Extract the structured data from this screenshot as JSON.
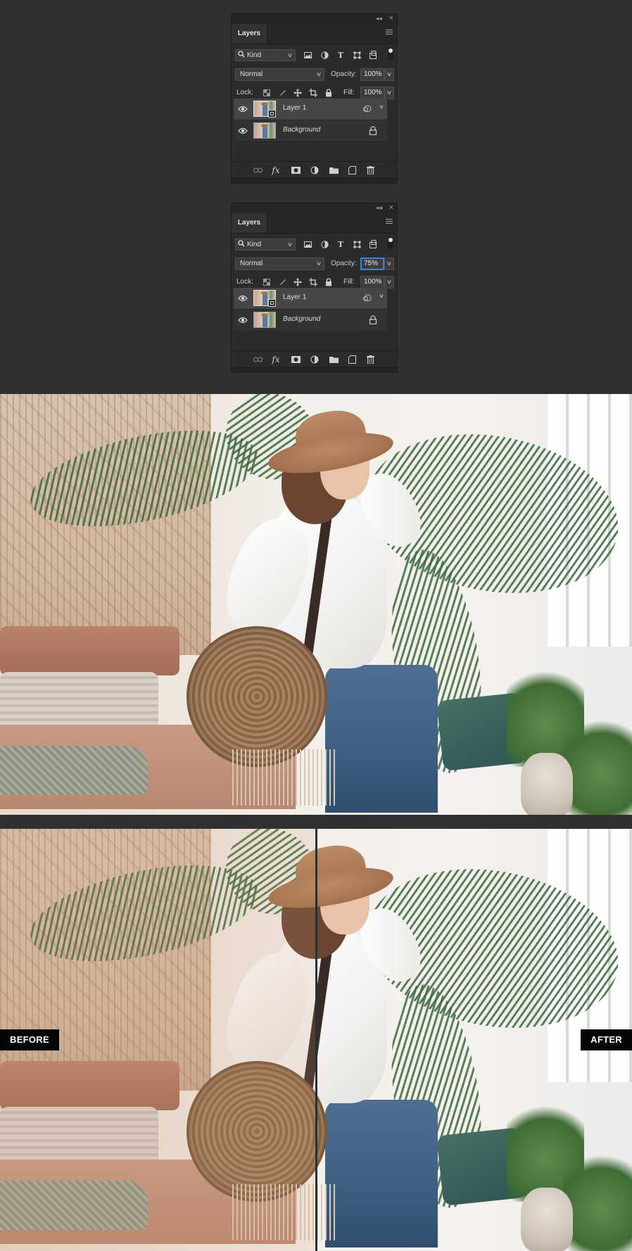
{
  "panel_top": {
    "tab_label": "Layers",
    "filter_kind": "Kind",
    "blend_mode": "Normal",
    "opacity_label": "Opacity:",
    "opacity_value": "100%",
    "lock_label": "Lock:",
    "fill_label": "Fill:",
    "fill_value": "100%",
    "layers": [
      {
        "name": "Layer 1"
      },
      {
        "name": "Background"
      }
    ]
  },
  "panel_bottom": {
    "tab_label": "Layers",
    "filter_kind": "Kind",
    "blend_mode": "Normal",
    "opacity_label": "Opacity:",
    "opacity_value": "75%",
    "lock_label": "Lock:",
    "fill_label": "Fill:",
    "fill_value": "100%",
    "layers": [
      {
        "name": "Layer 1"
      },
      {
        "name": "Background"
      }
    ]
  },
  "comparison": {
    "before_label": "BEFORE",
    "after_label": "AFTER"
  },
  "colors": {
    "app_background": "#313131",
    "panel_background": "#2b2b2b",
    "selected_layer": "#464646",
    "active_field_border": "#3b7fe0",
    "label_background": "#050505"
  },
  "icons": [
    "search-icon",
    "image-filter-icon",
    "adjustment-filter-icon",
    "type-filter-icon",
    "shape-filter-icon",
    "smart-object-filter-icon",
    "lock-transparent-icon",
    "lock-image-icon",
    "lock-position-icon",
    "lock-artboard-icon",
    "lock-all-icon",
    "eye-icon",
    "smart-object-icon",
    "link-icon",
    "lock-icon",
    "link-layers-icon",
    "fx-icon",
    "mask-icon",
    "adjustment-layer-icon",
    "folder-icon",
    "new-layer-icon",
    "trash-icon",
    "panel-menu-icon",
    "collapse-icon",
    "close-icon"
  ]
}
